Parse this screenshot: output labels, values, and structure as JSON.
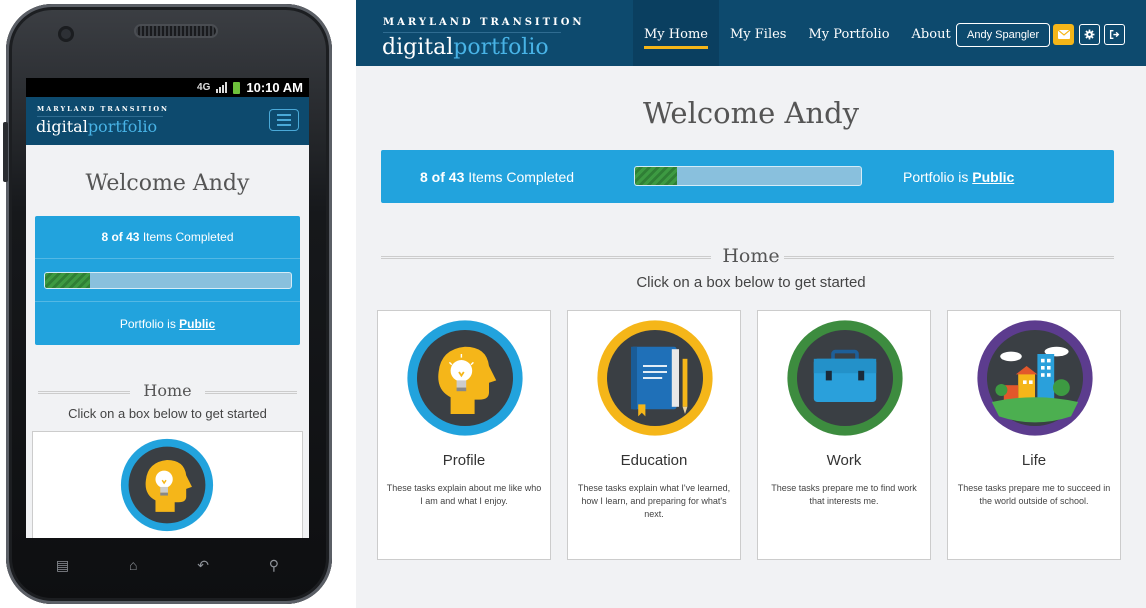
{
  "phone": {
    "status_time": "10:10 AM",
    "status_network": "4G",
    "logo_top": "MARYLAND TRANSITION",
    "logo_a": "digital",
    "logo_b": "portfolio",
    "welcome": "Welcome Andy",
    "progress_count": "8 of 43",
    "progress_label": " Items Completed",
    "progress_fraction": 0.186,
    "portfolio_prefix": "Portfolio is ",
    "portfolio_status": "Public",
    "section_title": "Home",
    "section_sub": "Click on a box below to get started"
  },
  "desktop": {
    "logo_top": "MARYLAND TRANSITION",
    "logo_a": "digital",
    "logo_b": "portfolio",
    "menu": [
      {
        "label": "My Home"
      },
      {
        "label": "My Files"
      },
      {
        "label": "My Portfolio"
      },
      {
        "label": "About"
      }
    ],
    "user_name": "Andy Spangler",
    "welcome": "Welcome Andy",
    "progress_count": "8 of 43",
    "progress_label": " Items Completed",
    "progress_fraction": 0.186,
    "portfolio_prefix": "Portfolio is ",
    "portfolio_status": "Public",
    "section_title": "Home",
    "section_sub": "Click on a box below to get started",
    "cards": [
      {
        "title": "Profile",
        "desc": "These tasks explain about me like who I am and what I enjoy.",
        "ring_color": "#22a3dd",
        "icon": "head-lightbulb-icon"
      },
      {
        "title": "Education",
        "desc": "These tasks explain what I've learned, how I learn, and preparing for what's next.",
        "ring_color": "#f5b619",
        "icon": "book-pencil-icon"
      },
      {
        "title": "Work",
        "desc": "These tasks prepare me to find work that interests me.",
        "ring_color": "#3d8c3f",
        "icon": "briefcase-icon"
      },
      {
        "title": "Life",
        "desc": "These tasks prepare me to succeed in the world outside of school.",
        "ring_color": "#5c3c8e",
        "icon": "city-houses-icon"
      }
    ]
  },
  "colors": {
    "navbar": "#0d4a6e",
    "panel": "#22a3dd",
    "accent": "#f5b619",
    "progress_fill": "#3d9a42"
  }
}
